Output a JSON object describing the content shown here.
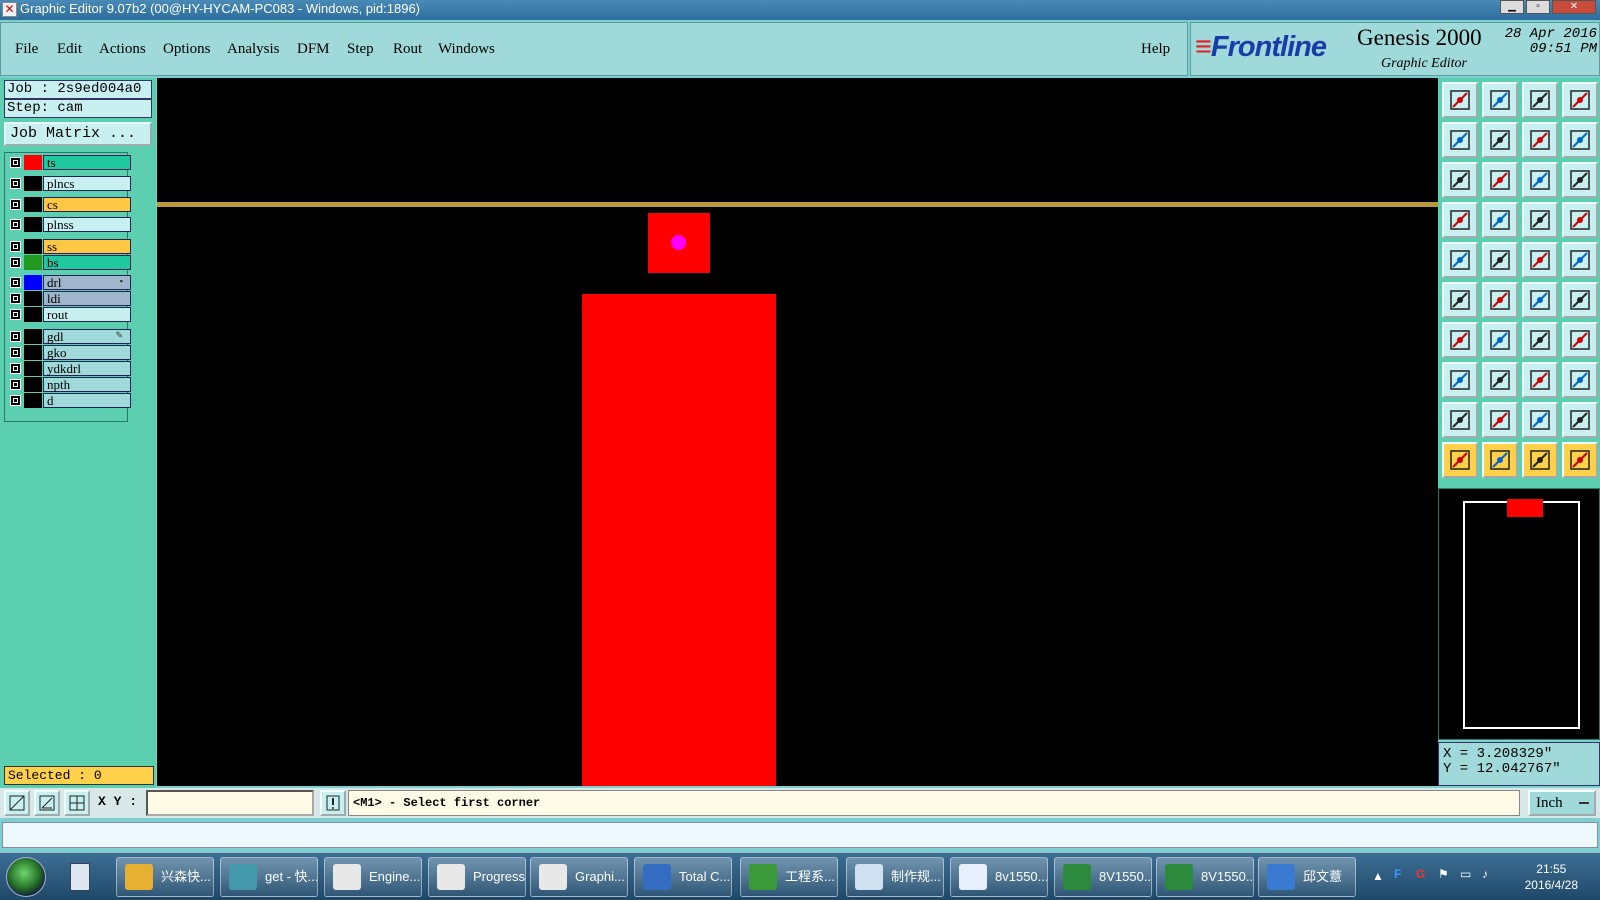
{
  "window": {
    "title": "Graphic Editor 9.07b2 (00@HY-HYCAM-PC083 - Windows, pid:1896)"
  },
  "menu": {
    "items": [
      "File",
      "Edit",
      "Actions",
      "Options",
      "Analysis",
      "DFM",
      "Step",
      "Rout",
      "Windows"
    ],
    "help": "Help"
  },
  "brand": {
    "logo": "Frontline",
    "product": "Genesis 2000",
    "subtitle": "Graphic Editor",
    "date": "28 Apr 2016",
    "time": "09:51 PM"
  },
  "job": {
    "job_label": "Job : 2s9ed004a0",
    "step_label": "Step: cam",
    "matrix_button": "Job Matrix ..."
  },
  "layers": [
    {
      "name": "ts",
      "color": "#ff0000",
      "bg": "#20c8a0"
    },
    {
      "name": "plncs",
      "color": "#000000",
      "bg": "#c9f0f0"
    },
    {
      "name": "cs",
      "color": "#000000",
      "bg": "#ffc844"
    },
    {
      "name": "plnss",
      "color": "#000000",
      "bg": "#c9f0f0"
    },
    {
      "name": "ss",
      "color": "#000000",
      "bg": "#ffc844"
    },
    {
      "name": "bs",
      "color": "#1f9a1f",
      "bg": "#20c8a0"
    },
    {
      "name": "drl",
      "color": "#0000ff",
      "bg": "#9fb6cc"
    },
    {
      "name": "ldi",
      "color": "#000000",
      "bg": "#9fb6cc"
    },
    {
      "name": "rout",
      "color": "#000000",
      "bg": "#c9f0f0"
    },
    {
      "name": "gdl",
      "color": "#000000",
      "bg": "#9fd9d9"
    },
    {
      "name": "gko",
      "color": "#000000",
      "bg": "#9fd9d9"
    },
    {
      "name": "ydkdrl",
      "color": "#000000",
      "bg": "#9fd9d9"
    },
    {
      "name": "npth",
      "color": "#000000",
      "bg": "#9fd9d9"
    },
    {
      "name": "d",
      "color": "#000000",
      "bg": "#9fd9d9"
    }
  ],
  "selected": {
    "label": "Selected : 0"
  },
  "coordinates": {
    "x_label": "X = 3.208329\"",
    "y_label": "Y = 12.042767\""
  },
  "command": {
    "xy_label": "X Y :",
    "xy_value": "",
    "prompt": "<M1> - Select first corner",
    "unit": "Inch"
  },
  "canvas_colors": {
    "background": "#000000",
    "feature": "#ff0000",
    "line": "#b89a3a",
    "pad_dot": "#ff00ff"
  },
  "taskbar": {
    "items": [
      {
        "label": "兴森快...",
        "icon": "folder-icon"
      },
      {
        "label": "get - 快...",
        "icon": "browser-icon"
      },
      {
        "label": "Engine...",
        "icon": "genesis-icon"
      },
      {
        "label": "Progress",
        "icon": "genesis-icon"
      },
      {
        "label": "Graphi...",
        "icon": "genesis-icon"
      },
      {
        "label": "Total C...",
        "icon": "disk-icon"
      },
      {
        "label": "工程系...",
        "icon": "app-icon"
      },
      {
        "label": "制作规...",
        "icon": "notepad-icon"
      },
      {
        "label": "8v1550...",
        "icon": "doc-icon"
      },
      {
        "label": "8V1550...",
        "icon": "excel-icon"
      },
      {
        "label": "8V1550...",
        "icon": "excel-icon"
      },
      {
        "label": "邱文薏",
        "icon": "chat-icon"
      }
    ],
    "clock_time": "21:55",
    "clock_date": "2016/4/28"
  }
}
